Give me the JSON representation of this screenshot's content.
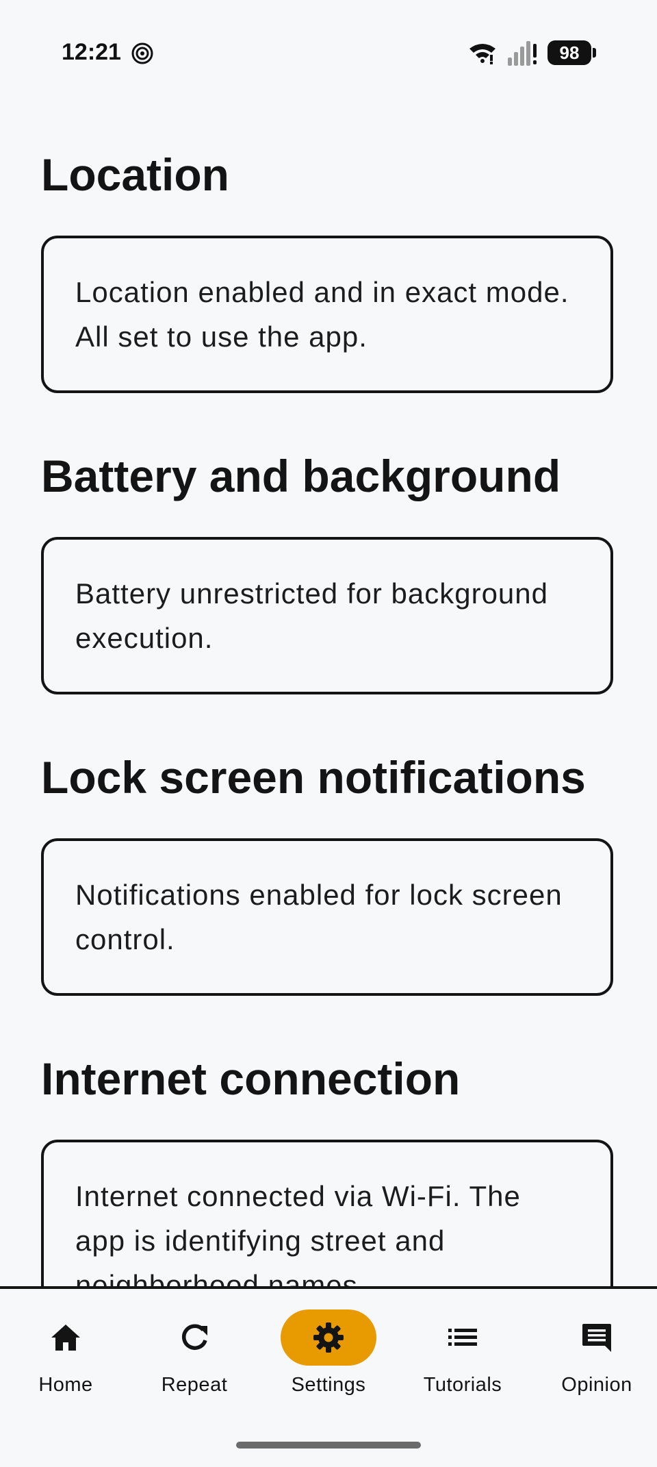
{
  "status_bar": {
    "time": "12:21",
    "battery_level": "98",
    "icons": [
      "app-notification-icon",
      "wifi-icon",
      "cell-signal-icon",
      "battery-icon"
    ]
  },
  "sections": [
    {
      "title": "Location",
      "text": "Location enabled and in exact mode. All set to use the app."
    },
    {
      "title": "Battery and background",
      "text": "Battery unrestricted for background execution."
    },
    {
      "title": "Lock screen notifications",
      "text": "Notifications enabled for lock screen control."
    },
    {
      "title": "Internet connection",
      "text": "Internet connected via Wi-Fi. The app is identifying street and neighborhood names."
    }
  ],
  "bottom_nav": {
    "items": [
      {
        "label": "Home",
        "icon": "home-icon",
        "active": false
      },
      {
        "label": "Repeat",
        "icon": "repeat-icon",
        "active": false
      },
      {
        "label": "Settings",
        "icon": "gear-icon",
        "active": true
      },
      {
        "label": "Tutorials",
        "icon": "list-icon",
        "active": false
      },
      {
        "label": "Opinion",
        "icon": "feedback-icon",
        "active": false
      }
    ]
  },
  "colors": {
    "background": "#f7f8fa",
    "text": "#141414",
    "active_pill": "#e89b00"
  }
}
